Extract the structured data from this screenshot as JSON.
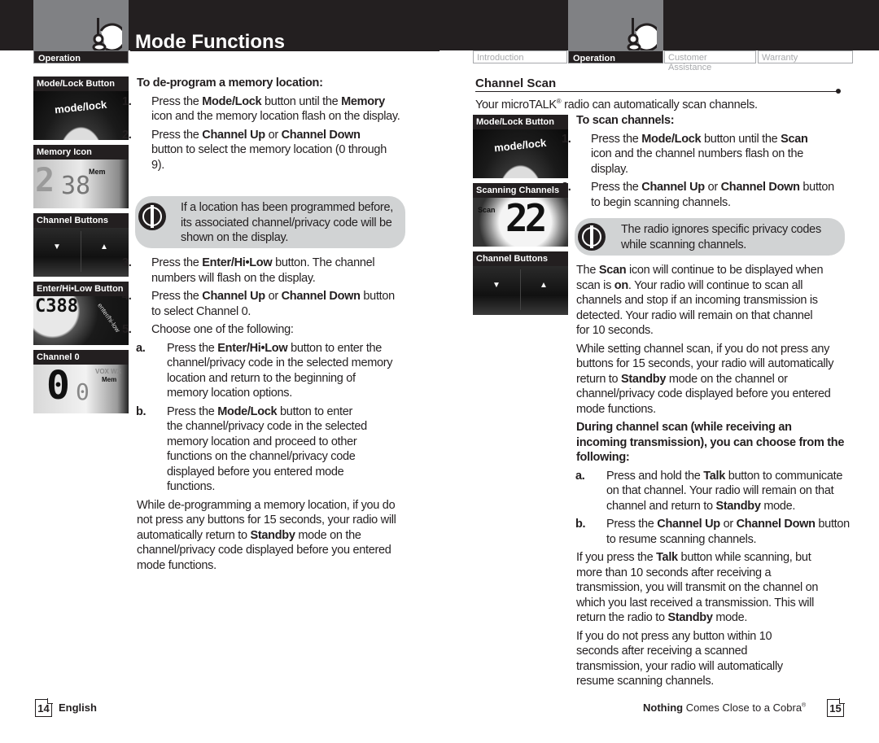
{
  "header": {
    "title": "Mode Functions",
    "section_tab_left": "Operation",
    "nav_tabs": [
      {
        "label": "Introduction",
        "active": false
      },
      {
        "label": "Operation",
        "active": true
      },
      {
        "label": "Customer Assistance",
        "active": false
      },
      {
        "label": "Warranty",
        "active": false
      }
    ],
    "section_icon": "radio-operation-icon"
  },
  "left_page": {
    "thumbnails": [
      {
        "caption": "Mode/Lock Button",
        "image": "mode-lock-button-photo",
        "label_text": "mode/lock"
      },
      {
        "caption": "Memory Icon",
        "image": "memory-icon-lcd-photo"
      },
      {
        "caption": "Channel Buttons",
        "image": "channel-buttons-photo"
      },
      {
        "caption": "Enter/Hi•Low Button",
        "image": "enter-hilow-button-photo"
      },
      {
        "caption": "Channel 0",
        "image": "channel-0-lcd-photo"
      }
    ],
    "heading": "To de-program a memory location:",
    "steps": [
      {
        "num": "1.",
        "parts": [
          "Press the ",
          "Mode/Lock",
          " button until the ",
          "Memory",
          " icon and the memory location flash on the display."
        ]
      },
      {
        "num": "2.",
        "parts": [
          "Press the ",
          "Channel Up",
          " or ",
          "Channel Down",
          " button to select the memory location (0 through 9)."
        ]
      },
      {
        "num": "3.",
        "parts": [
          "Press the ",
          "Enter/Hi•Low",
          " button. The channel numbers will flash on the display."
        ]
      },
      {
        "num": "4.",
        "parts": [
          "Press the ",
          "Channel Up",
          " or ",
          "Channel Down",
          " button to select Channel 0."
        ]
      },
      {
        "num": "5.",
        "parts": [
          "Choose one of the following:"
        ]
      }
    ],
    "note": "If a location has been programmed before, its associated channel/privacy code will be shown on the display.",
    "sub_steps": [
      {
        "num": "a.",
        "parts": [
          "Press the ",
          "Enter/Hi•Low",
          " button to enter the channel/privacy code in the selected memory location and return to the beginning of memory location options."
        ]
      },
      {
        "num": "b.",
        "parts": [
          "Press the ",
          "Mode/Lock",
          " button to enter the channel/privacy code in the selected memory location and proceed to other functions on the channel/privacy code displayed before you entered mode functions."
        ]
      }
    ],
    "closing": [
      "While de-programming a memory location, if you do not press any buttons for 15 seconds, your radio will automatically return to ",
      "Standby",
      " mode on the channel/privacy code displayed before you entered mode functions."
    ],
    "footer": {
      "page_number": "14",
      "language": "English"
    }
  },
  "right_page": {
    "section_title": "Channel Scan",
    "intro": [
      "Your microTALK",
      "®",
      " radio can automatically scan channels."
    ],
    "thumbnails": [
      {
        "caption": "Mode/Lock Button",
        "image": "mode-lock-button-photo",
        "label_text": "mode/lock"
      },
      {
        "caption": "Scanning Channels",
        "image": "scanning-channels-lcd-photo",
        "lcd_text": "22",
        "scan_label": "Scan"
      },
      {
        "caption": "Channel Buttons",
        "image": "channel-buttons-photo"
      }
    ],
    "heading": "To scan channels:",
    "steps": [
      {
        "num": "1.",
        "parts": [
          "Press the ",
          "Mode/Lock",
          " button until the ",
          "Scan",
          " icon and the channel numbers flash on the display."
        ]
      },
      {
        "num": "2.",
        "parts": [
          "Press the ",
          "Channel Up",
          " or ",
          "Channel Down",
          " button to begin scanning channels."
        ]
      }
    ],
    "note": "The radio ignores specific privacy codes while scanning channels.",
    "para1": [
      "The ",
      "Scan",
      " icon will continue to be displayed when scan is ",
      "on",
      ". Your radio will continue to scan all channels and stop if an incoming transmission is detected. Your radio will remain on that channel for 10 seconds."
    ],
    "para2": [
      "While setting channel scan, if you do not press any buttons for 15 seconds, your radio will automatically return to ",
      "Standby",
      " mode on the channel or channel/privacy code displayed before you entered mode functions."
    ],
    "during_heading": "During channel scan (while receiving an incoming transmission), you can choose from the following:",
    "sub_steps": [
      {
        "num": "a.",
        "parts": [
          "Press and hold the ",
          "Talk",
          " button to communicate on that channel. Your radio will remain on that channel and return to ",
          "Standby",
          " mode."
        ]
      },
      {
        "num": "b.",
        "parts": [
          "Press the ",
          "Channel Up",
          " or ",
          "Channel Down",
          " button to resume scanning channels."
        ]
      }
    ],
    "para3": [
      "If you press the ",
      "Talk",
      " button while scanning, but more than 10 seconds after receiving a transmission, you will transmit on the channel on which you last received a transmission. This will return the radio to ",
      "Standby",
      " mode."
    ],
    "para4": "If you do not press any button within 10 seconds after receiving a scanned transmission, your radio will automatically resume scanning channels.",
    "footer": {
      "tagline_bold": "Nothing",
      "tagline_rest": " Comes Close to a Cobra",
      "registered": "®",
      "page_number": "15"
    }
  },
  "colors": {
    "banner": "#231f20",
    "tab_grey": "#808184",
    "note_bg": "#d1d3d4",
    "inactive_tab_text": "#a7a9ac"
  }
}
